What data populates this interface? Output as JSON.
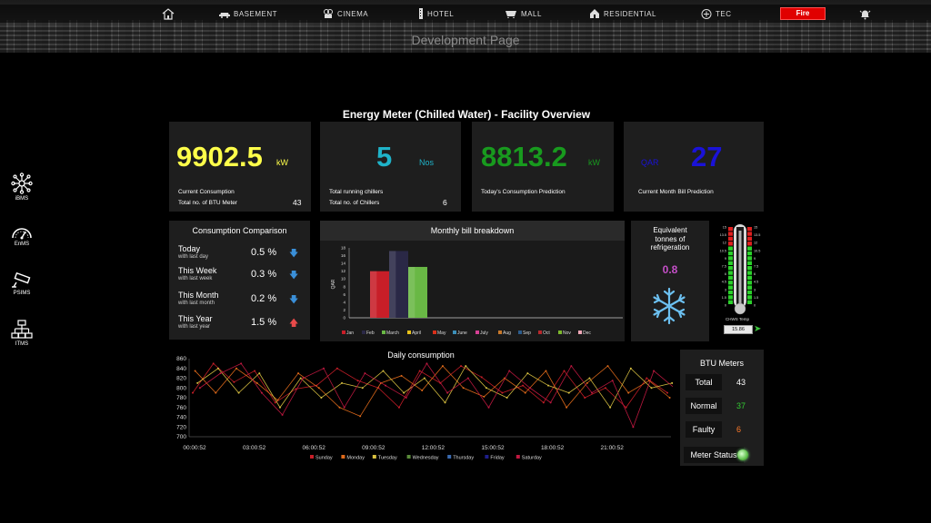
{
  "nav": {
    "items": [
      "BASEMENT",
      "CINEMA",
      "HOTEL",
      "MALL",
      "RESIDENTIAL",
      "TEC"
    ],
    "fire_label": "Fire"
  },
  "dev_page": "Development Page",
  "sidebar": {
    "items": [
      "iBMS",
      "EnMS",
      "PSIMS",
      "ITMS"
    ]
  },
  "title": "Energy Meter (Chilled Water) - Facility Overview",
  "cards": {
    "consumption": {
      "value": "9902.5",
      "unit": "kW",
      "label": "Current Consumption",
      "sub_label": "Total no. of BTU Meter",
      "sub_value": "43",
      "color": "#ffff4a"
    },
    "chillers": {
      "value": "5",
      "unit": "Nos",
      "label": "Total running chillers",
      "sub_label": "Total no. of Chillers",
      "sub_value": "6",
      "color": "#1fb3c9"
    },
    "prediction": {
      "value": "8813.2",
      "unit": "kW",
      "label": "Today's Consumption Prediction",
      "color": "#189a1e"
    },
    "bill": {
      "value": "27",
      "unit": "QAR",
      "label": "Current Month Bill Prediction",
      "color": "#1a12d8"
    }
  },
  "comparison": {
    "title": "Consumption Comparison",
    "rows": [
      {
        "label": "Today",
        "sub": "with last day",
        "value": "0.5 %",
        "dir": "down"
      },
      {
        "label": "This Week",
        "sub": "with last week",
        "value": "0.3 %",
        "dir": "down"
      },
      {
        "label": "This Month",
        "sub": "with last month",
        "value": "0.2 %",
        "dir": "down"
      },
      {
        "label": "This Year",
        "sub": "with last year",
        "value": "1.5 %",
        "dir": "up"
      }
    ]
  },
  "monthly": {
    "title": "Monthly bill breakdown",
    "ylabel": "QAR",
    "yticks": [
      "18",
      "16",
      "14",
      "12",
      "10",
      "8",
      "6",
      "4",
      "2",
      "0"
    ],
    "months": [
      "Jan",
      "Feb",
      "March",
      "April",
      "May",
      "June",
      "July",
      "Aug",
      "Sep",
      "Oct",
      "Nov",
      "Dec"
    ],
    "colors": [
      "#c81e28",
      "#2a2846",
      "#69b845",
      "#e8c21a",
      "#d8301a",
      "#3c8fb8",
      "#d64095",
      "#c8782a",
      "#2c5c8c",
      "#b8282c",
      "#7cb82c",
      "#f0a8b8"
    ],
    "values": [
      12,
      17.2,
      13.1,
      0,
      0,
      0,
      0,
      0,
      0,
      0,
      0,
      0
    ]
  },
  "refrigeration": {
    "title_l1": "Equivalent",
    "title_l2": "tonnes of",
    "title_l3": "refrigeration",
    "value": "0.8"
  },
  "thermo": {
    "left_ticks": [
      "15",
      "13.5",
      "12",
      "10.5",
      "9",
      "7.5",
      "6",
      "4.5",
      "3",
      "1.5",
      "0"
    ],
    "right_ticks": [
      "15",
      "13.5",
      "12",
      "10.5",
      "9",
      "7.5",
      "6",
      "4.5",
      "3",
      "1.5",
      "0"
    ],
    "label": "CHWS Temp",
    "value": "15.86"
  },
  "daily": {
    "title": "Daily consumption",
    "yticks": [
      "860",
      "840",
      "820",
      "800",
      "780",
      "760",
      "740",
      "720",
      "700"
    ],
    "xticks": [
      "00:00:52",
      "03:00:52",
      "06:00:52",
      "09:00:52",
      "12:00:52",
      "15:00:52",
      "18:00:52",
      "21:00:52"
    ],
    "legend": [
      {
        "name": "Sunday",
        "color": "#c81e28"
      },
      {
        "name": "Monday",
        "color": "#e06a1a"
      },
      {
        "name": "Tuesday",
        "color": "#d8c040"
      },
      {
        "name": "Wednesday",
        "color": "#5a8c3a"
      },
      {
        "name": "Thursday",
        "color": "#3a6ab0"
      },
      {
        "name": "Friday",
        "color": "#1e1e8c"
      },
      {
        "name": "Saturday",
        "color": "#c01840"
      }
    ]
  },
  "btu": {
    "title": "BTU Meters",
    "rows": [
      {
        "label": "Total",
        "value": "43",
        "color": "#ffffff"
      },
      {
        "label": "Normal",
        "value": "37",
        "color": "#33cc33"
      },
      {
        "label": "Faulty",
        "value": "6",
        "color": "#ff7a2a"
      }
    ],
    "status_label": "Meter Status"
  },
  "chart_data": [
    {
      "type": "bar",
      "title": "Monthly bill breakdown",
      "ylabel": "QAR",
      "categories": [
        "Jan",
        "Feb",
        "March",
        "April",
        "May",
        "June",
        "July",
        "Aug",
        "Sep",
        "Oct",
        "Nov",
        "Dec"
      ],
      "values": [
        12,
        17.2,
        13.1,
        0,
        0,
        0,
        0,
        0,
        0,
        0,
        0,
        0
      ],
      "ylim": [
        0,
        18
      ]
    },
    {
      "type": "line",
      "title": "Daily consumption",
      "ylim": [
        700,
        860
      ],
      "x": [
        "00:00:52",
        "03:00:52",
        "06:00:52",
        "09:00:52",
        "12:00:52",
        "15:00:52",
        "18:00:52",
        "21:00:52"
      ],
      "series": [
        {
          "name": "Sunday",
          "values": [
            790,
            850,
            812,
            835,
            770,
            798,
            805,
            840,
            815,
            800,
            760,
            835,
            810,
            845,
            822,
            790,
            805,
            770,
            835,
            780,
            800,
            760,
            820,
            790
          ]
        },
        {
          "name": "Monday",
          "values": [
            835,
            790,
            840,
            810,
            775,
            830,
            800,
            760,
            742,
            810,
            825,
            795,
            845,
            800,
            782,
            820,
            790,
            835,
            760,
            810,
            845,
            790,
            815,
            780
          ]
        },
        {
          "name": "Tuesday",
          "values": [
            810,
            840,
            790,
            830,
            760,
            820,
            780,
            810,
            800,
            835,
            790,
            820,
            770,
            845,
            800,
            780,
            830,
            805,
            790,
            820,
            760,
            840,
            800,
            810
          ]
        },
        {
          "name": "Saturday",
          "values": [
            800,
            830,
            850,
            790,
            745,
            820,
            840,
            760,
            830,
            805,
            780,
            850,
            790,
            820,
            760,
            835,
            800,
            770,
            845,
            790,
            815,
            720,
            835,
            800
          ]
        }
      ]
    }
  ]
}
